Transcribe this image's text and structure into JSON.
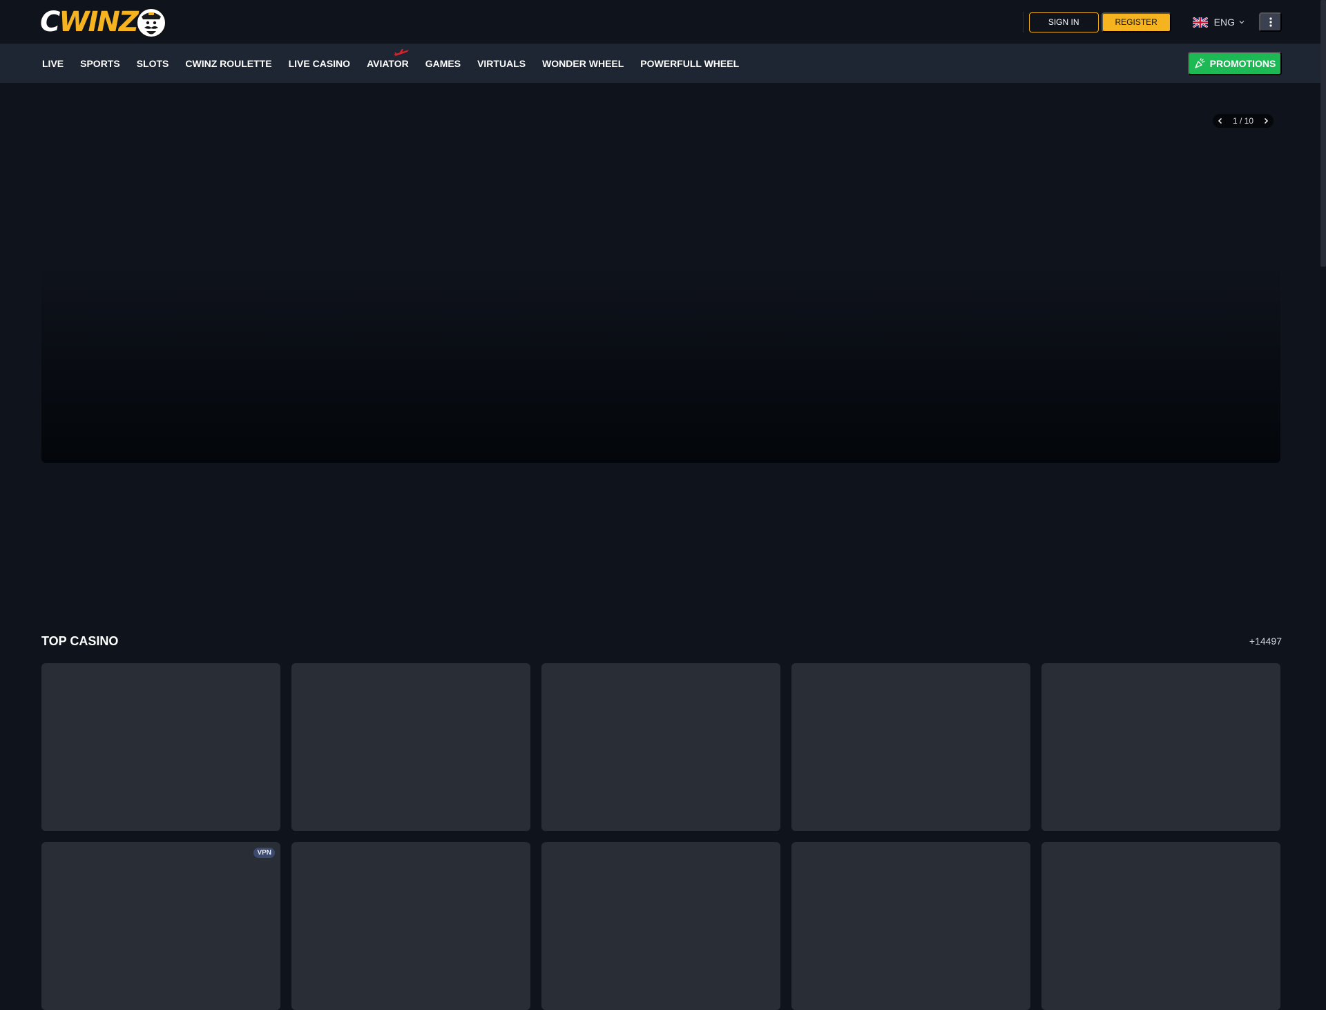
{
  "header": {
    "logo": {
      "text_c": "C",
      "text_winz": "WINZ"
    },
    "signin_label": "SIGN IN",
    "register_label": "REGISTER",
    "language_label": "ENG",
    "icons": {
      "flag": "uk-flag-icon",
      "language_chevron": "chevron-down-icon",
      "more": "vertical-dots-icon"
    }
  },
  "nav": {
    "items": [
      {
        "label": "LIVE"
      },
      {
        "label": "SPORTS"
      },
      {
        "label": "SLOTS"
      },
      {
        "label": "CWINZ ROULETTE"
      },
      {
        "label": "LIVE CASINO"
      },
      {
        "label": "AVIATOR"
      },
      {
        "label": "GAMES"
      },
      {
        "label": "VIRTUALS"
      },
      {
        "label": "WONDER WHEEL"
      },
      {
        "label": "POWERFULL WHEEL"
      }
    ],
    "promotions_label": "PROMOTIONS"
  },
  "hero": {
    "pager_text": "1 / 10",
    "current_slide": 1,
    "total_slides": 10
  },
  "top_casino": {
    "title": "TOP CASINO",
    "count": "+14497",
    "tiles": [
      {
        "badge": ""
      },
      {
        "badge": ""
      },
      {
        "badge": ""
      },
      {
        "badge": ""
      },
      {
        "badge": ""
      },
      {
        "badge": "VPN"
      },
      {
        "badge": ""
      },
      {
        "badge": ""
      },
      {
        "badge": ""
      },
      {
        "badge": ""
      }
    ]
  },
  "colors": {
    "background": "#0f131c",
    "nav_background": "#1e2533",
    "accent_yellow": "#f5b320",
    "promotions_green": "#1db954",
    "tile_placeholder": "#292d36"
  }
}
